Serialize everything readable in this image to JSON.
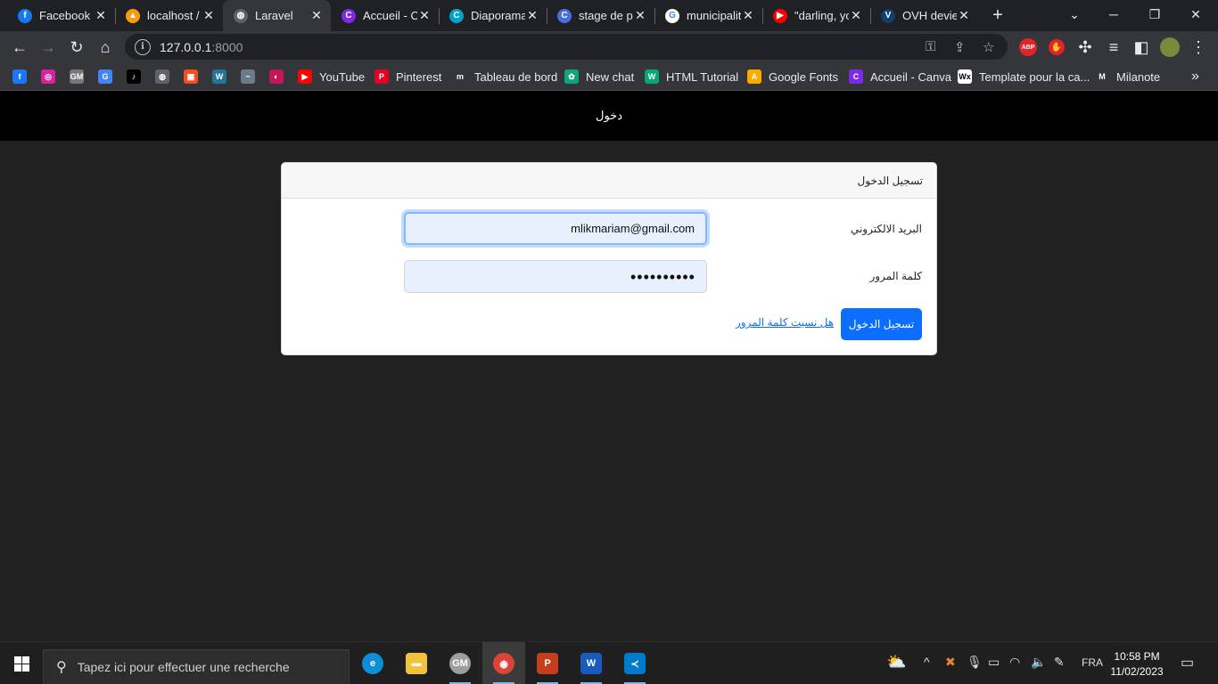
{
  "tabs": [
    {
      "title": "Facebook",
      "icon": "facebook-icon",
      "color": "#1877f2",
      "glyph": "f"
    },
    {
      "title": "localhost /",
      "icon": "phpmyadmin-icon",
      "color": "#f89c0e",
      "glyph": "▲"
    },
    {
      "title": "Laravel",
      "icon": "globe-icon",
      "color": "#5f6368",
      "glyph": "◍"
    },
    {
      "title": "Accueil - C",
      "icon": "canva-icon",
      "color": "#7d2ae8",
      "glyph": "C"
    },
    {
      "title": "Diaporama",
      "icon": "canva-icon",
      "color": "#00a3c9",
      "glyph": "C"
    },
    {
      "title": "stage de p",
      "icon": "canva-icon",
      "color": "#4a6ee0",
      "glyph": "C"
    },
    {
      "title": "municipalit",
      "icon": "google-icon",
      "color": "#ffffff",
      "glyph": "G"
    },
    {
      "title": "\"darling, yo",
      "icon": "youtube-icon",
      "color": "#ff0000",
      "glyph": "▶"
    },
    {
      "title": "OVH devie",
      "icon": "ovh-icon",
      "color": "#123f6d",
      "glyph": "V"
    }
  ],
  "address": {
    "host": "127.0.0.1",
    "port": ":8000"
  },
  "bookmarks": [
    {
      "label": "",
      "icon": "facebook-icon",
      "color": "#1877f2",
      "glyph": "f"
    },
    {
      "label": "",
      "icon": "instagram-icon",
      "color": "#d6249f",
      "glyph": "◎"
    },
    {
      "label": "",
      "icon": "gm-icon",
      "color": "#777777",
      "glyph": "GM"
    },
    {
      "label": "",
      "icon": "translate-icon",
      "color": "#4285f4",
      "glyph": "G"
    },
    {
      "label": "",
      "icon": "tiktok-icon",
      "color": "#000000",
      "glyph": "♪"
    },
    {
      "label": "",
      "icon": "globe-icon",
      "color": "#5f6368",
      "glyph": "◍"
    },
    {
      "label": "",
      "icon": "microsoft-icon",
      "color": "#f25022",
      "glyph": "▦"
    },
    {
      "label": "",
      "icon": "wordpress-icon",
      "color": "#21759b",
      "glyph": "W"
    },
    {
      "label": "",
      "icon": "bookmark-icon",
      "color": "#6c7a89",
      "glyph": "~"
    },
    {
      "label": "",
      "icon": "circle-icon",
      "color": "#c2185b",
      "glyph": "◐"
    },
    {
      "label": "YouTube",
      "icon": "youtube-icon",
      "color": "#ff0000",
      "glyph": "▶"
    },
    {
      "label": "Pinterest",
      "icon": "pinterest-icon",
      "color": "#e60023",
      "glyph": "P"
    },
    {
      "label": "Tableau de bord",
      "icon": "dashboard-icon",
      "color": "#35363a",
      "glyph": "m"
    },
    {
      "label": "New chat",
      "icon": "chatgpt-icon",
      "color": "#10a37f",
      "glyph": "✿"
    },
    {
      "label": "HTML Tutorial",
      "icon": "w3schools-icon",
      "color": "#04aa6d",
      "glyph": "W"
    },
    {
      "label": "Google Fonts",
      "icon": "google-fonts-icon",
      "color": "#f9ab00",
      "glyph": "A"
    },
    {
      "label": "Accueil - Canva",
      "icon": "canva-icon",
      "color": "#7d2ae8",
      "glyph": "C"
    },
    {
      "label": "Template pour la ca...",
      "icon": "wix-icon",
      "color": "#ffffff",
      "glyph": "Wx"
    },
    {
      "label": "Milanote",
      "icon": "milanote-icon",
      "color": "#35363a",
      "glyph": "M"
    }
  ],
  "page": {
    "nav_link": "دخول",
    "card_title": "تسجيل الدخول",
    "email_label": "البريد الالكتروني",
    "email_value": "mlikmariam@gmail.com",
    "password_label": "كلمة المرور",
    "password_value": "••••••••••",
    "login_button": "تسجيل الدخول",
    "forgot_link": "هل نسيت كلمة المرور"
  },
  "taskbar": {
    "search_placeholder": "Tapez ici pour effectuer une recherche",
    "apps": [
      {
        "icon": "edge-icon",
        "color": "#0c8fd6",
        "glyph": "e"
      },
      {
        "icon": "file-explorer-icon",
        "color": "#f3c13a",
        "glyph": "▬"
      },
      {
        "icon": "gm-app-icon",
        "color": "#9e9e9e",
        "glyph": "GM"
      },
      {
        "icon": "chrome-icon",
        "color": "#db4437",
        "glyph": "◉"
      },
      {
        "icon": "powerpoint-icon",
        "color": "#c43e1c",
        "glyph": "P"
      },
      {
        "icon": "word-icon",
        "color": "#185abd",
        "glyph": "W"
      },
      {
        "icon": "vscode-icon",
        "color": "#007acc",
        "glyph": "≺"
      }
    ],
    "language": "FRA",
    "time": "10:58 PM",
    "date": "11/02/2023"
  },
  "colors": {
    "accent": "#0d6efd",
    "navbar": "#000000",
    "page_bg": "#212121"
  }
}
